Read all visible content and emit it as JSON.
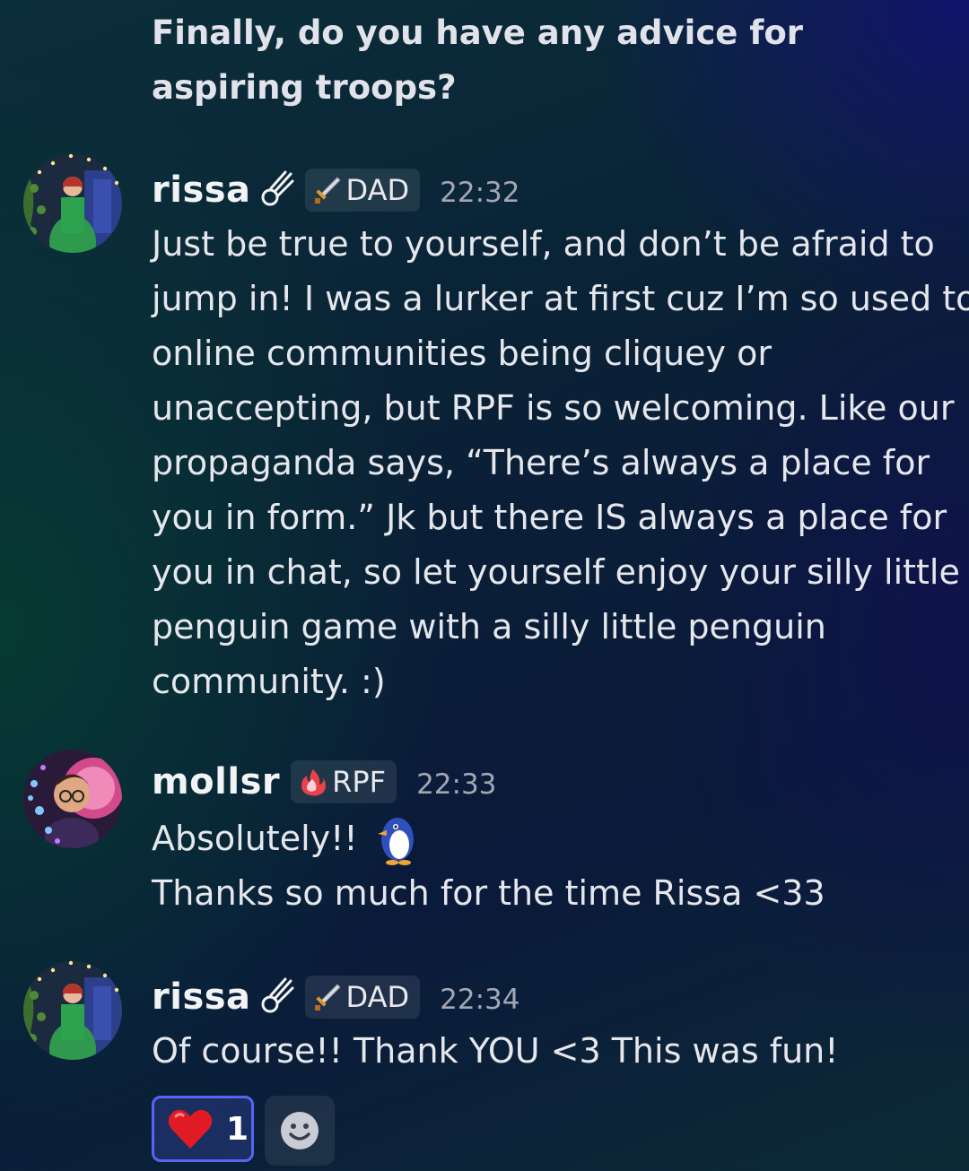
{
  "question": {
    "text": "Finally, do you have any advice for aspiring troops?"
  },
  "messages": [
    {
      "username": "rissa",
      "role": "DAD",
      "time": "22:32",
      "text": "Just be true to yourself, and don’t be afraid to jump in! I was a lurker at first cuz I’m so used to online communities being cliquey or unaccepting, but RPF is so welcoming. Like our propaganda says, “There’s always a place for you in form.” Jk but there IS always a place for you in chat, so let yourself enjoy your silly little penguin game with a silly little penguin community. :)",
      "lines": [
        "Just be true to yourself, and don’t be afraid to",
        "jump in! I was a lurker at first cuz I’m so used to",
        "online communities being cliquey or",
        "unaccepting, but RPF is so welcoming. Like our",
        "propaganda says, “There’s always a place for",
        "you in form.” Jk but there IS always a place for",
        "you in chat, so let yourself enjoy your silly little",
        "penguin game with a silly little penguin",
        "community. :)"
      ]
    },
    {
      "username": "mollsr",
      "role": "RPF",
      "time": "22:33",
      "lines": [
        "Absolutely!!",
        "Thanks so much for the time Rissa <33"
      ],
      "emoji": "penguin-emoji"
    },
    {
      "username": "rissa",
      "role": "DAD",
      "time": "22:34",
      "lines": [
        "Of course!! Thank YOU <3 This was fun!"
      ],
      "reactions": [
        {
          "emoji": "heart-emoji",
          "count": "1",
          "selected": true
        }
      ],
      "add_reaction_icon": "smiley-add-reaction-icon"
    }
  ],
  "colors": {
    "accent": "#5865f2",
    "timestamp": "#a3a7b3",
    "text": "#e6e7ec"
  }
}
